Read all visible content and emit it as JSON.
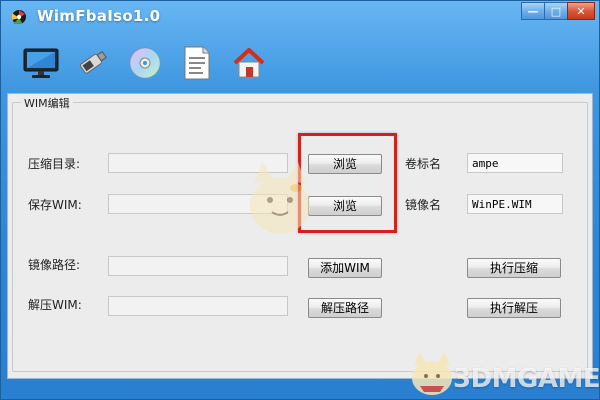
{
  "window": {
    "title": "WimFbaIso1.0",
    "controls": {
      "minimize": "—",
      "maximize": "□",
      "close": "✕"
    }
  },
  "toolbar": {
    "items": [
      {
        "icon": "monitor-icon"
      },
      {
        "icon": "usb-drive-icon"
      },
      {
        "icon": "disc-icon"
      },
      {
        "icon": "document-icon"
      },
      {
        "icon": "home-icon"
      }
    ]
  },
  "wim_edit": {
    "group_title": "WIM编辑",
    "compress_dir": {
      "label": "压缩目录:",
      "value": "",
      "browse": "浏览"
    },
    "save_wim": {
      "label": "保存WIM:",
      "value": "",
      "browse": "浏览"
    },
    "volume_name": {
      "label": "卷标名",
      "value": "ampe"
    },
    "image_name": {
      "label": "镜像名",
      "value": "WinPE.WIM"
    },
    "image_path": {
      "label": "镜像路径:",
      "value": "",
      "add_button": "添加WIM"
    },
    "extract_wim": {
      "label": "解压WIM:",
      "value": "",
      "path_button": "解压路径"
    },
    "run_compress": "执行压缩",
    "run_extract": "执行解压"
  },
  "watermark": {
    "text": "3DMGAME"
  },
  "colors": {
    "accent": "#3f97e0",
    "highlight": "#d61f1f",
    "panel": "#ececec"
  }
}
